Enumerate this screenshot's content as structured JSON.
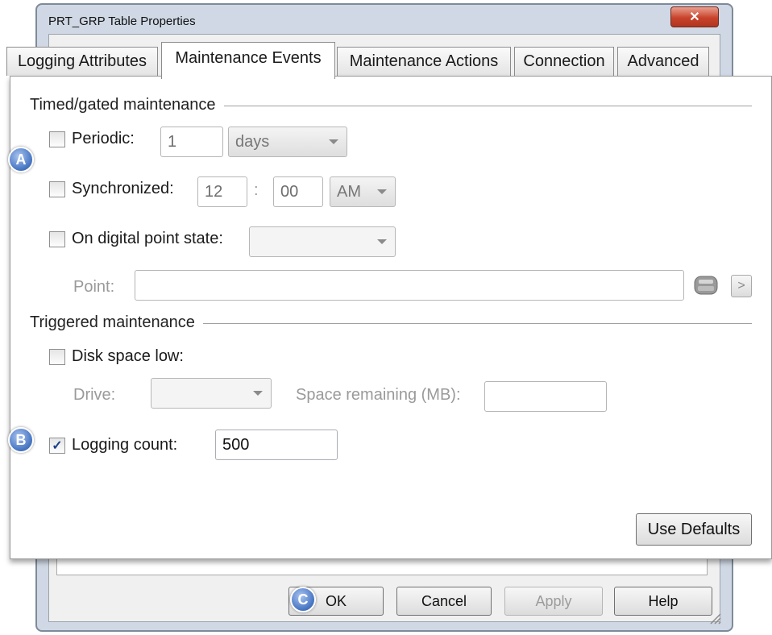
{
  "window": {
    "title": "PRT_GRP Table Properties",
    "close_glyph": "✕"
  },
  "tabs": [
    {
      "label": "Logging Attributes",
      "active": false
    },
    {
      "label": "Maintenance Events",
      "active": true
    },
    {
      "label": "Maintenance Actions",
      "active": false
    },
    {
      "label": "Connection",
      "active": false
    },
    {
      "label": "Advanced",
      "active": false
    }
  ],
  "timed": {
    "title": "Timed/gated maintenance",
    "periodic": {
      "label": "Periodic:",
      "checked": false,
      "value": "1",
      "unit": "days"
    },
    "synchronized": {
      "label": "Synchronized:",
      "checked": false,
      "hour": "12",
      "separator": ":",
      "minute": "00",
      "ampm": "AM"
    },
    "digital": {
      "label": "On digital point state:",
      "checked": false,
      "value": ""
    },
    "point": {
      "label": "Point:",
      "value": "",
      "browse_icon": "tag-browse-icon",
      "more_glyph": ">"
    }
  },
  "triggered": {
    "title": "Triggered maintenance",
    "disk": {
      "label": "Disk space low:",
      "checked": false
    },
    "drive": {
      "label": "Drive:",
      "value": ""
    },
    "space": {
      "label": "Space remaining (MB):",
      "value": ""
    },
    "logging_count": {
      "label": "Logging count:",
      "checked": true,
      "check_glyph": "✓",
      "value": "500"
    }
  },
  "buttons": {
    "use_defaults": "Use Defaults",
    "ok": "OK",
    "cancel": "Cancel",
    "apply": "Apply",
    "help": "Help"
  },
  "callouts": {
    "a": "A",
    "b": "B",
    "c": "C"
  },
  "colors": {
    "accent": "#4a78c4",
    "close": "#c8422b",
    "dialog_frame": "#cfd8e4"
  }
}
